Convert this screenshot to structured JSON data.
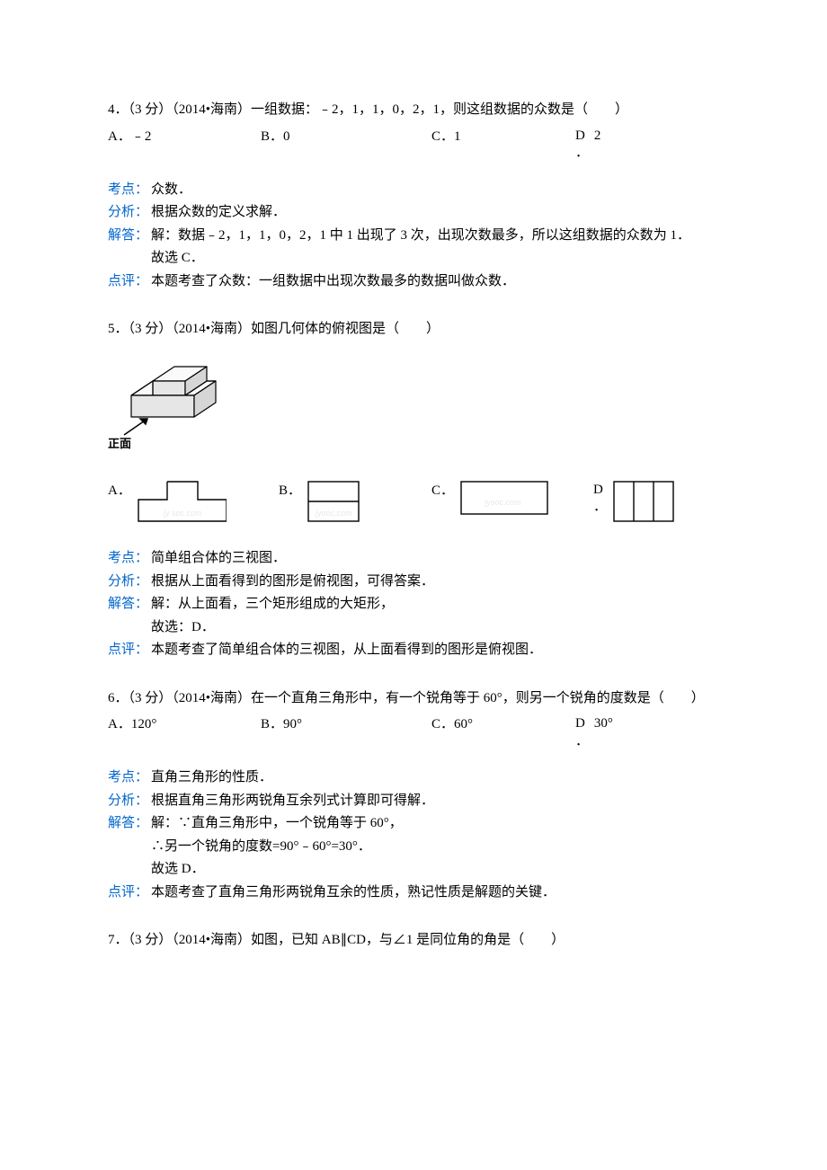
{
  "q4": {
    "stem": "4．（3 分）（2014•海南）一组数据：﹣2，1，1，0，2，1，则这组数据的众数是（　　）",
    "opts": {
      "a": "A．﹣2",
      "b": "B．0",
      "c": "C．1",
      "d_letter": "D",
      "d_dot": "．",
      "d_val": "2"
    },
    "kaodian_label": "考点：",
    "kaodian": "众数．",
    "fenxi_label": "分析：",
    "fenxi": "根据众数的定义求解．",
    "jieda_label": "解答：",
    "jieda_l1": "解：数据﹣2，1，1，0，2，1 中 1 出现了 3 次，出现次数最多，所以这组数据的众数为 1．",
    "jieda_l2": "故选 C．",
    "dianping_label": "点评：",
    "dianping": "本题考查了众数：一组数据中出现次数最多的数据叫做众数．"
  },
  "q5": {
    "stem": "5．（3 分）（2014•海南）如图几何体的俯视图是（　　）",
    "front_label": "正面",
    "opts": {
      "a": "A．",
      "b": "B．",
      "c": "C．",
      "d_letter": "D",
      "d_dot": "．"
    },
    "kaodian_label": "考点：",
    "kaodian": "简单组合体的三视图．",
    "fenxi_label": "分析：",
    "fenxi": "根据从上面看得到的图形是俯视图，可得答案．",
    "jieda_label": "解答：",
    "jieda_l1": "解：从上面看，三个矩形组成的大矩形，",
    "jieda_l2": "故选：D．",
    "dianping_label": "点评：",
    "dianping": "本题考查了简单组合体的三视图，从上面看得到的图形是俯视图．"
  },
  "q6": {
    "stem": "6．（3 分）（2014•海南）在一个直角三角形中，有一个锐角等于 60°，则另一个锐角的度数是（　　）",
    "opts": {
      "a": "A．120°",
      "b": "B．90°",
      "c": "C．60°",
      "d_letter": "D",
      "d_dot": "．",
      "d_val": "30°"
    },
    "kaodian_label": "考点：",
    "kaodian": "直角三角形的性质．",
    "fenxi_label": "分析：",
    "fenxi": "根据直角三角形两锐角互余列式计算即可得解．",
    "jieda_label": "解答：",
    "jieda_l1": "解：∵直角三角形中，一个锐角等于 60°，",
    "jieda_l2": "∴另一个锐角的度数=90°﹣60°=30°．",
    "jieda_l3": "故选 D．",
    "dianping_label": "点评：",
    "dianping": "本题考查了直角三角形两锐角互余的性质，熟记性质是解题的关键．"
  },
  "q7": {
    "stem": "7．（3 分）（2014•海南）如图，已知 AB∥CD，与∠1 是同位角的角是（　　）"
  }
}
